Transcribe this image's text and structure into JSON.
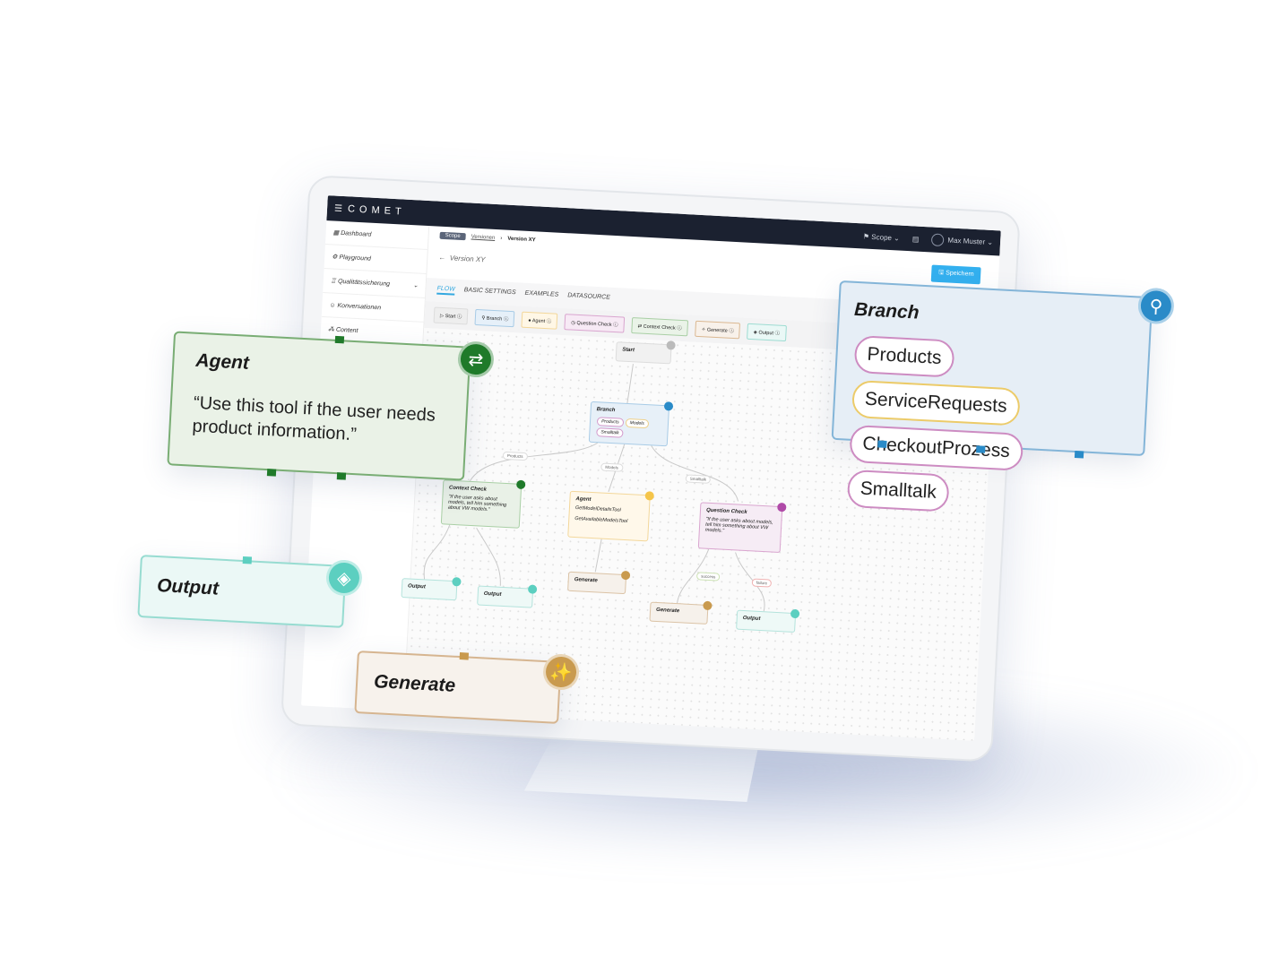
{
  "app": {
    "logo": "COMET",
    "menu_icon": "hamburger-icon"
  },
  "navbar": {
    "scope": "Scope",
    "user": "Max Muster"
  },
  "sidebar": {
    "items": [
      {
        "label": "Dashboard"
      },
      {
        "label": "Playground"
      },
      {
        "label": "Qualitätssicherung"
      },
      {
        "label": "Konversationen"
      },
      {
        "label": "Content"
      }
    ]
  },
  "breadcrumb": {
    "scope": "Scope",
    "versions": "Versionen",
    "current": "Version XY"
  },
  "page": {
    "title": "Version XY",
    "save": "Speichern"
  },
  "tabs": [
    {
      "label": "FLOW",
      "active": true
    },
    {
      "label": "BASIC SETTINGS"
    },
    {
      "label": "EXAMPLES"
    },
    {
      "label": "DATASOURCE"
    }
  ],
  "toolbar": [
    {
      "label": "Start"
    },
    {
      "label": "Branch"
    },
    {
      "label": "Agent"
    },
    {
      "label": "Question Check"
    },
    {
      "label": "Context Check"
    },
    {
      "label": "Generate"
    },
    {
      "label": "Output"
    }
  ],
  "flow": {
    "start": "Start",
    "branch": {
      "title": "Branch",
      "options": [
        "Products",
        "Models",
        "Smalltalk"
      ]
    },
    "edges": {
      "products": "Products",
      "models": "Models",
      "smalltalk": "Smalltalk",
      "success": "success",
      "failure": "failure"
    },
    "context_check": {
      "title": "Context Check",
      "text": "\"If the user asks about models, tell him something about VW models.\""
    },
    "agent": {
      "title": "Agent",
      "tools": [
        "GetModelDetailsTool",
        "GetAvailableModelsTool"
      ]
    },
    "question_check": {
      "title": "Question Check",
      "text": "\"If the user asks about models, tell him something about VW models.\""
    },
    "output": "Output",
    "generate": "Generate"
  },
  "cards": {
    "agent": {
      "title": "Agent",
      "text": "“Use this tool if the user needs product information.”"
    },
    "branch": {
      "title": "Branch",
      "options": [
        "Products",
        "ServiceRequests",
        "CheckoutProzess",
        "Smalltalk"
      ]
    },
    "output": {
      "title": "Output"
    },
    "generate": {
      "title": "Generate"
    }
  },
  "colors": {
    "navbar": "#1b2130",
    "accent": "#33b0ef",
    "agent": "#1f7a2a",
    "branch": "#2a8bc8",
    "output": "#5ccfc0",
    "generate": "#c99a4e",
    "question": "#b04aa8"
  }
}
